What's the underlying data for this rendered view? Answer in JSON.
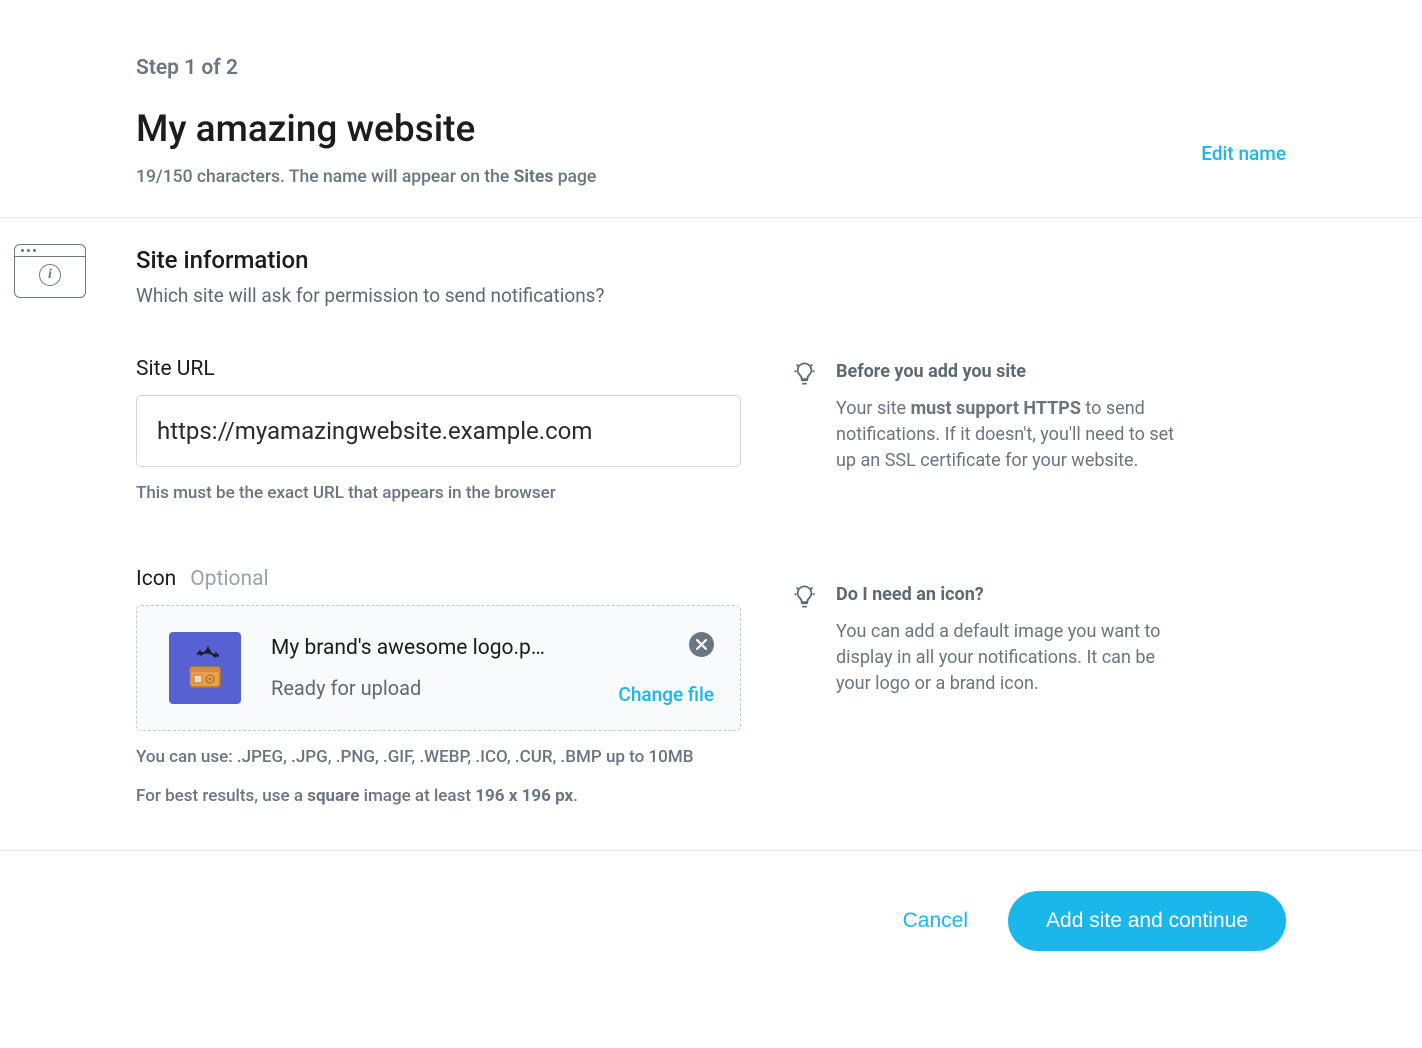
{
  "header": {
    "step": "Step 1 of 2",
    "site_name": "My amazing website",
    "char_hint_pre": "19/150 characters. The name will appear on the ",
    "char_hint_bold": "Sites",
    "char_hint_post": " page",
    "edit_name": "Edit name"
  },
  "section": {
    "title": "Site information",
    "subtitle": "Which site will ask for permission to send notifications?"
  },
  "url_field": {
    "label": "Site URL",
    "value": "https://myamazingwebsite.example.com",
    "hint": "This must be the exact URL that appears in the browser"
  },
  "icon_field": {
    "label": "Icon",
    "optional": "Optional",
    "file_name": "My brand's awesome logo.p…",
    "status": "Ready for upload",
    "change_file": "Change file",
    "hint1": "You can use: .JPEG, .JPG, .PNG, .GIF, .WEBP, .ICO, .CUR, .BMP up to 10MB",
    "hint2_pre": "For best results, use a ",
    "hint2_b1": "square",
    "hint2_mid": " image at least ",
    "hint2_b2": "196 x 196 px",
    "hint2_post": "."
  },
  "tips": {
    "before": {
      "title": "Before you add you site",
      "pre": "Your site ",
      "bold": "must support HTTPS",
      "post": " to send notifications. If it doesn't, you'll need to set up an SSL certificate for your website."
    },
    "icon": {
      "title": "Do I need an icon?",
      "text": "You can add a default image you want to display in all your notifications. It can be your logo or a brand icon."
    }
  },
  "footer": {
    "cancel": "Cancel",
    "primary": "Add site and continue"
  }
}
